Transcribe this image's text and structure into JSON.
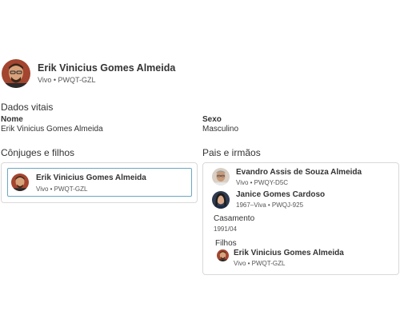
{
  "person": {
    "name": "Erik Vinicius Gomes Almeida",
    "status_id": "Vivo • PWQT-GZL"
  },
  "vitals": {
    "title": "Dados vitais",
    "name_label": "Nome",
    "name_value": "Erik Vinicius Gomes Almeida",
    "sex_label": "Sexo",
    "sex_value": "Masculino"
  },
  "spouses_children": {
    "title": "Cônjuges e filhos",
    "person_name": "Erik Vinicius Gomes Almeida",
    "person_sub": "Vivo • PWQT-GZL"
  },
  "parents_siblings": {
    "title": "Pais e irmãos",
    "father_name": "Evandro Assis de Souza Almeida",
    "father_sub": "Vivo • PWQY-D5C",
    "mother_name": "Janice Gomes Cardoso",
    "mother_sub": "1967–Viva • PWQJ-925",
    "marriage_label": "Casamento",
    "marriage_date": "1991/04",
    "children_label": "Filhos",
    "child_name": "Erik Vinicius Gomes Almeida",
    "child_sub": "Vivo • PWQT-GZL"
  },
  "colors": {
    "accent_border": "#6aa9c2",
    "card_border": "#d9d9d9"
  },
  "icons": [
    "person-avatar-photo"
  ]
}
